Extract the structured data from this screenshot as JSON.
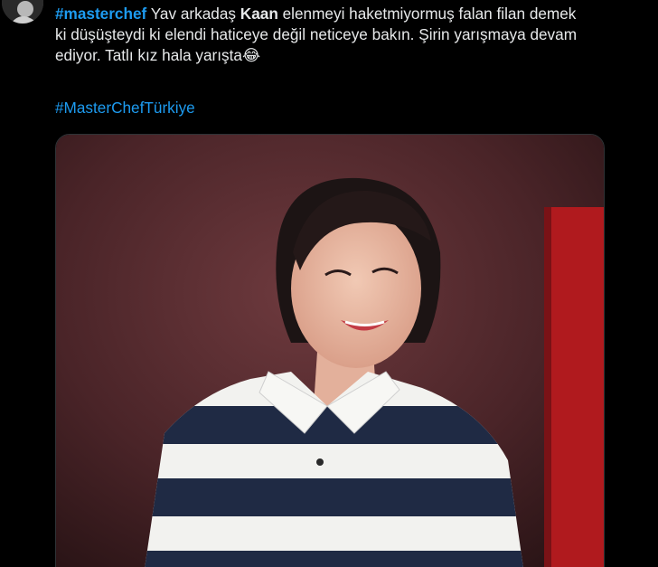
{
  "tweet": {
    "hashtag_1": "#masterchef",
    "text_1": " Yav arkadaş ",
    "bold_name": "Kaan",
    "text_2": " elenmeyi haketmiyormuş falan filan demek",
    "line_2": "ki düşüşteydi ki elendi haticeye değil neticeye bakın. Şirin yarışmaya devam",
    "line_3": "ediyor. Tatlı kız hala yarışta",
    "emoji": "😂",
    "hashtag_2": "#MasterChefTürkiye"
  },
  "icons": {
    "avatar": "profile-avatar",
    "emoji": "face-with-tears-of-joy"
  },
  "colors": {
    "background": "#000000",
    "text": "#e7e9ea",
    "link": "#1d9bf0",
    "photo_backdrop": "#5a2a2e",
    "photo_red_panel": "#b01a1e",
    "shirt_navy": "#1f2a44",
    "shirt_white": "#f2f2ef"
  }
}
